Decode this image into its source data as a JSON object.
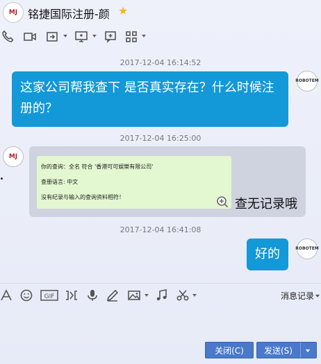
{
  "header": {
    "avatar_text": "MJ",
    "title": "铭捷国际注册-颜",
    "star_icon": "star-icon"
  },
  "toolbar_top": {
    "icons": [
      "phone-icon",
      "video-icon",
      "share-icon",
      "screen-share-icon",
      "add-chat-icon",
      "apps-icon"
    ]
  },
  "messages": [
    {
      "time": "2017-12-04 16:14:52",
      "sender": "self",
      "text": "这家公司帮我查下  是否真实存在？什么时候注册的？"
    },
    {
      "time": "2017-12-04 16:25:00",
      "sender": "other",
      "image_lines": [
        "你的查询：全名 符合 '香港可可娱樂有限公司'",
        "查册语言: 中文",
        "没有纪录与输入的查询资料相符！"
      ],
      "text": "查无记录哦"
    },
    {
      "time": "2017-12-04 16:41:08",
      "sender": "self",
      "text": "好的"
    }
  ],
  "self_avatar_text": "ROBOTEM",
  "toolbar_bottom": {
    "icons": [
      "font-icon",
      "emoji-icon",
      "gif-icon",
      "clip-icon",
      "mic-icon",
      "pen-icon",
      "image-icon",
      "music-icon",
      "scissors-icon"
    ],
    "history_label": "消息记录"
  },
  "buttons": {
    "close_label": "关闭(C)",
    "send_label": "发送(S)"
  },
  "colors": {
    "bubble_blue": "#1398d8",
    "button_blue": "#4a79c9",
    "image_bg": "#e3f7d1"
  }
}
